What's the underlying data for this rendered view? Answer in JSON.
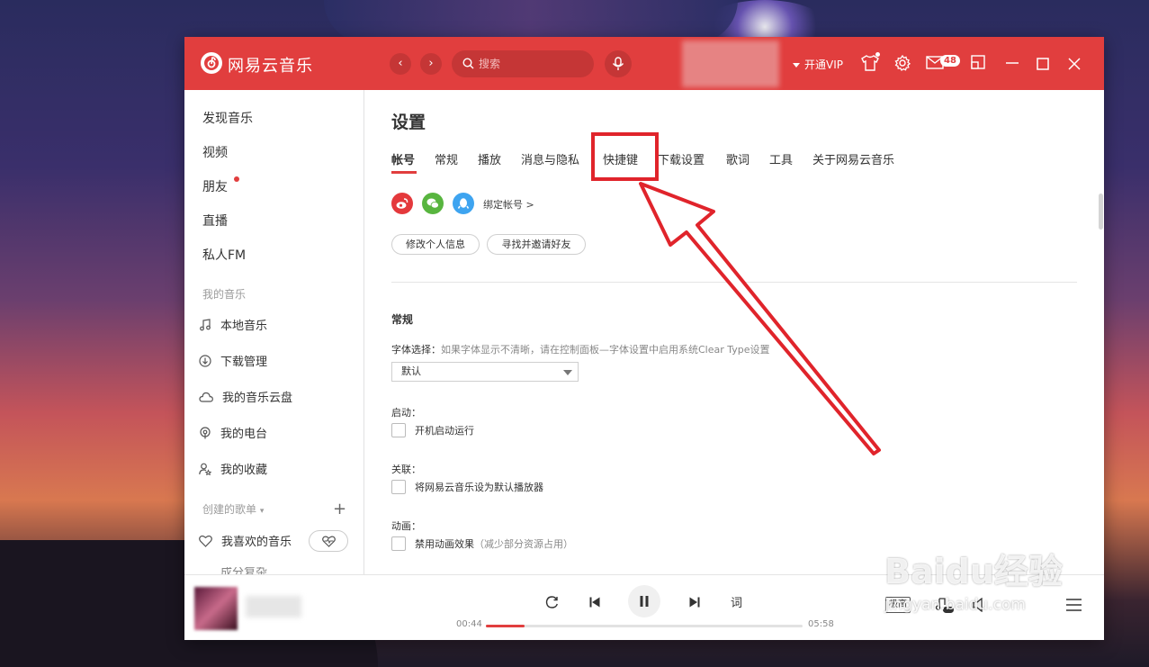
{
  "header": {
    "app_name": "网易云音乐",
    "search_placeholder": "搜索",
    "vip_label": "开通VIP",
    "mail_badge": "48"
  },
  "sidebar": {
    "main_items": [
      {
        "label": "发现音乐"
      },
      {
        "label": "视频"
      },
      {
        "label": "朋友"
      },
      {
        "label": "直播"
      },
      {
        "label": "私人FM"
      }
    ],
    "my_music_title": "我的音乐",
    "my_music_items": [
      {
        "label": "本地音乐",
        "icon": "music-note-icon"
      },
      {
        "label": "下载管理",
        "icon": "download-icon"
      },
      {
        "label": "我的音乐云盘",
        "icon": "cloud-icon"
      },
      {
        "label": "我的电台",
        "icon": "radio-icon"
      },
      {
        "label": "我的收藏",
        "icon": "person-star-icon"
      }
    ],
    "playlists_title": "创建的歌单",
    "liked_label": "我喜欢的音乐",
    "partial_label": "成分复杂"
  },
  "settings": {
    "title": "设置",
    "tabs": [
      {
        "label": "帐号"
      },
      {
        "label": "常规"
      },
      {
        "label": "播放"
      },
      {
        "label": "消息与隐私"
      },
      {
        "label": "快捷键"
      },
      {
        "label": "下载设置"
      },
      {
        "label": "歌词"
      },
      {
        "label": "工具"
      },
      {
        "label": "关于网易云音乐"
      }
    ],
    "active_tab": "帐号",
    "highlighted_tab": "快捷键",
    "bind_account": "绑定帐号 >",
    "edit_profile": "修改个人信息",
    "find_friends": "寻找并邀请好友",
    "general_heading": "常规",
    "font_label": "字体选择：",
    "font_hint": "如果字体显示不清晰，请在控制面板—字体设置中启用系统Clear Type设置",
    "font_value": "默认",
    "startup_label": "启动：",
    "startup_option": "开机启动运行",
    "assoc_label": "关联：",
    "assoc_option": "将网易云音乐设为默认播放器",
    "anim_label": "动画：",
    "anim_option": "禁用动画效果",
    "anim_hint": "（减少部分资源占用）"
  },
  "player": {
    "elapsed": "00:44",
    "duration": "05:58",
    "progress": 0.123,
    "lyric_label": "词",
    "quality_label": "极高"
  },
  "watermark": {
    "brand": "Baidu经验",
    "url": "jingyan.baidu.com"
  },
  "colors": {
    "brand_red": "#e13e3e",
    "annotation_red": "#e0242b"
  }
}
